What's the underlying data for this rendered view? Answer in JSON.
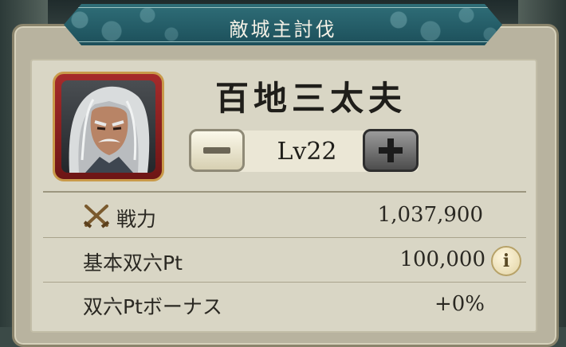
{
  "header": {
    "title": "敵城主討伐"
  },
  "boss": {
    "name": "百地三太夫"
  },
  "level": {
    "text": "Lv22",
    "minus_symbol": "−",
    "plus_symbol": "+"
  },
  "stats": [
    {
      "label": "戦力",
      "value": "1,037,900",
      "icon": "crossed-swords-icon"
    },
    {
      "label": "基本双六Pt",
      "value": "100,000",
      "icon": "info-icon"
    },
    {
      "label": "双六Ptボーナス",
      "value": "+0%"
    }
  ],
  "info_symbol": "i",
  "colors": {
    "banner": "#1c4f5a",
    "portrait_frame": "#a62b2b",
    "panel": "#d9d6c5",
    "text": "#2a2822"
  }
}
